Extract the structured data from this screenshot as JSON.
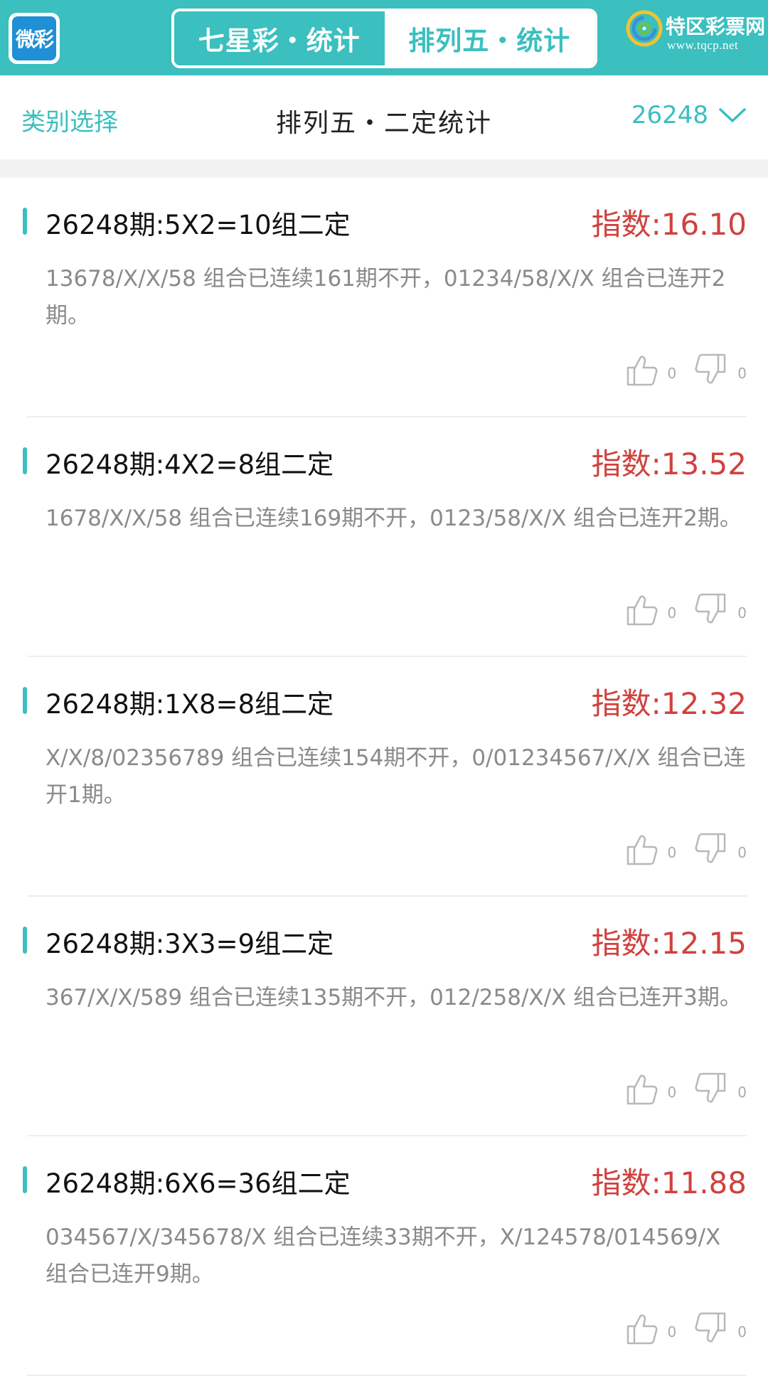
{
  "header": {
    "logo_text": "微彩",
    "tabs": [
      {
        "label": "七星彩・统计",
        "active": false
      },
      {
        "label": "排列五・统计",
        "active": true
      }
    ],
    "brand_name": "特区彩票网",
    "brand_url": "www.tqcp.net"
  },
  "subheader": {
    "category_label": "类别选择",
    "title": "排列五・二定统计",
    "issue": "26248"
  },
  "colors": {
    "accent": "#3bbfbf",
    "index_red": "#d0413e",
    "desc_gray": "#8a8a8a"
  },
  "items": [
    {
      "title": "26248期:5X2=10组二定",
      "index": "指数:16.10",
      "desc": "13678/X/X/58 组合已连续161期不开，01234/58/X/X 组合已连开2期。",
      "likes": "0",
      "dislikes": "0"
    },
    {
      "title": "26248期:4X2=8组二定",
      "index": "指数:13.52",
      "desc": "1678/X/X/58 组合已连续169期不开，0123/58/X/X 组合已连开2期。",
      "likes": "0",
      "dislikes": "0"
    },
    {
      "title": "26248期:1X8=8组二定",
      "index": "指数:12.32",
      "desc": "X/X/8/02356789 组合已连续154期不开，0/01234567/X/X 组合已连开1期。",
      "likes": "0",
      "dislikes": "0"
    },
    {
      "title": "26248期:3X3=9组二定",
      "index": "指数:12.15",
      "desc": "367/X/X/589 组合已连续135期不开，012/258/X/X 组合已连开3期。",
      "likes": "0",
      "dislikes": "0"
    },
    {
      "title": "26248期:6X6=36组二定",
      "index": "指数:11.88",
      "desc": "034567/X/345678/X 组合已连续33期不开，X/124578/014569/X 组合已连开9期。",
      "likes": "0",
      "dislikes": "0"
    }
  ]
}
